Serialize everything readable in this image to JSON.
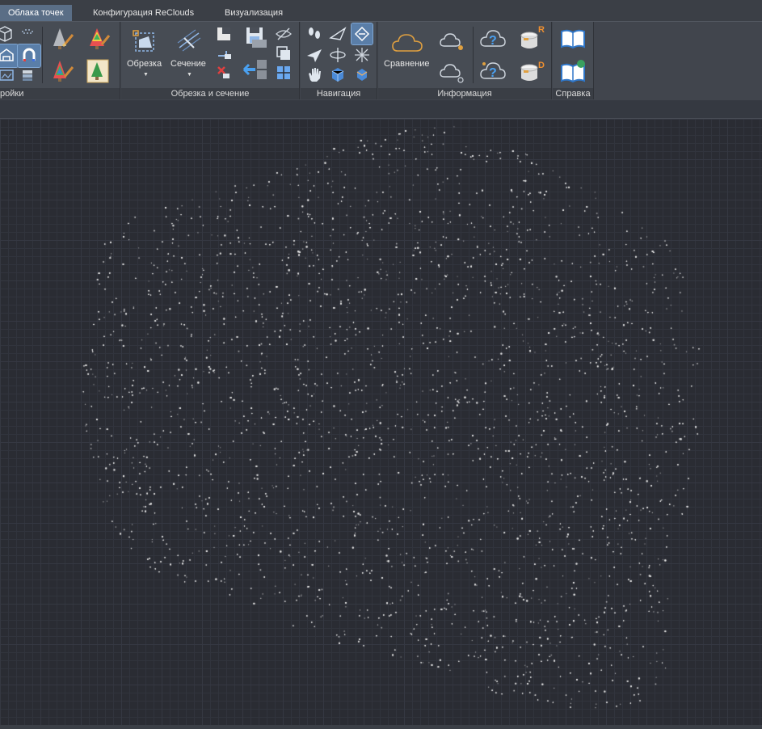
{
  "tabs": [
    {
      "label": "Облака точек",
      "active": true
    },
    {
      "label": "Конфигурация ReClouds",
      "active": false
    },
    {
      "label": "Визуализация",
      "active": false
    }
  ],
  "panels": {
    "settings": {
      "title": "ройки"
    },
    "clip": {
      "title": "Обрезка и сечение",
      "crop_label": "Обрезка",
      "section_label": "Сечение"
    },
    "nav": {
      "title": "Навигация"
    },
    "info": {
      "title": "Информация",
      "compare_label": "Сравнение",
      "r_badge": "R",
      "d_badge": "D"
    },
    "help": {
      "title": "Справка"
    }
  },
  "colors": {
    "accent": "#5a7ea8",
    "viewport_bg": "#2a2c33",
    "points": "#e8e8e8"
  }
}
